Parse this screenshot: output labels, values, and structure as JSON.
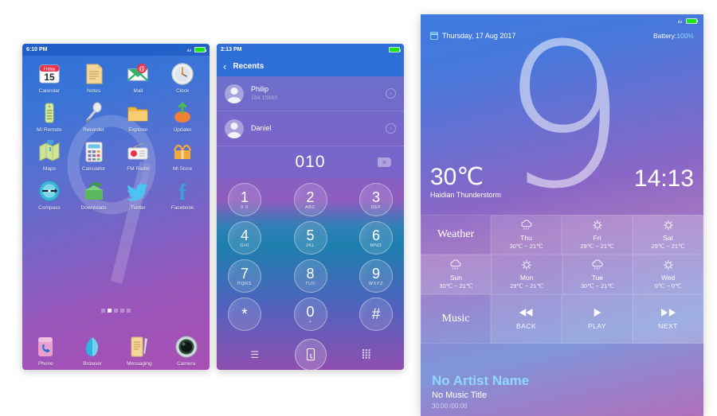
{
  "phone1": {
    "status": {
      "time": "6:10 PM",
      "signal_icon": "signal-icon",
      "battery_icon": "battery-full-icon"
    },
    "apps": [
      [
        {
          "label": "Calendar",
          "icon": "calendar-icon",
          "day": "Friday",
          "date": "15"
        },
        {
          "label": "Notes",
          "icon": "notes-icon"
        },
        {
          "label": "Mail",
          "icon": "mail-icon"
        },
        {
          "label": "Clock",
          "icon": "clock-icon"
        }
      ],
      [
        {
          "label": "Mi Remote",
          "icon": "remote-icon"
        },
        {
          "label": "Recorder",
          "icon": "microphone-icon"
        },
        {
          "label": "Explorer",
          "icon": "folder-icon"
        },
        {
          "label": "Updater",
          "icon": "updater-icon"
        }
      ],
      [
        {
          "label": "Maps",
          "icon": "map-icon"
        },
        {
          "label": "Calculator",
          "icon": "calculator-icon"
        },
        {
          "label": "FM Radio",
          "icon": "radio-icon"
        },
        {
          "label": "Mi Store",
          "icon": "store-icon"
        }
      ],
      [
        {
          "label": "Compass",
          "icon": "compass-icon"
        },
        {
          "label": "Downloads",
          "icon": "download-box-icon"
        },
        {
          "label": "Twitter",
          "icon": "twitter-icon"
        },
        {
          "label": "Facebook",
          "icon": "facebook-icon"
        }
      ]
    ],
    "page_dots": {
      "count": 5,
      "active_index": 1
    },
    "dock": [
      {
        "label": "Phone",
        "icon": "phone-icon"
      },
      {
        "label": "Browser",
        "icon": "browser-icon"
      },
      {
        "label": "Messaging",
        "icon": "messaging-icon"
      },
      {
        "label": "Camera",
        "icon": "camera-icon"
      }
    ]
  },
  "phone2": {
    "status": {
      "time": "2:13 PM",
      "battery_icon": "battery-full-icon"
    },
    "appbar": {
      "back_icon": "chevron-left-icon",
      "title": "Recents"
    },
    "contacts": [
      {
        "name": "Philip",
        "number": "184    15669",
        "avatar": "person-avatar",
        "arrow": "chevron-right-icon"
      },
      {
        "name": "Daniel",
        "number": "",
        "avatar": "person-avatar",
        "arrow": "chevron-right-icon"
      }
    ],
    "dialed_number": "010",
    "delete_icon": "backspace-icon",
    "keypad": [
      [
        {
          "digit": "1",
          "letters": "0 0"
        },
        {
          "digit": "2",
          "letters": "ABC"
        },
        {
          "digit": "3",
          "letters": "DEF"
        }
      ],
      [
        {
          "digit": "4",
          "letters": "GHI"
        },
        {
          "digit": "5",
          "letters": "JKL"
        },
        {
          "digit": "6",
          "letters": "MNO"
        }
      ],
      [
        {
          "digit": "7",
          "letters": "PQRS"
        },
        {
          "digit": "8",
          "letters": "TUV"
        },
        {
          "digit": "9",
          "letters": "WXYZ"
        }
      ],
      [
        {
          "digit": "*",
          "letters": ""
        },
        {
          "digit": "0",
          "letters": "+"
        },
        {
          "digit": "#",
          "letters": ""
        }
      ]
    ],
    "bottom_bar": {
      "menu_icon": "menu-lines-icon",
      "call_icon": "call-dial-icon",
      "keypad_icon": "keypad-dots-icon"
    }
  },
  "phone3": {
    "status": {
      "signal_icon": "signal-icon",
      "battery_icon": "battery-full-icon"
    },
    "header": {
      "calendar_icon": "calendar-icon",
      "date": "Thursday, 17 Aug 2017",
      "battery_label": "Battery:",
      "battery_value": "100%"
    },
    "big_digit": "9",
    "weather_now": {
      "temperature": "30℃",
      "location": "Haidian Thunderstorm"
    },
    "clock": "14:13",
    "weather_section_label": "Weather",
    "forecast": [
      {
        "day": "Thu",
        "range": "30℃ ~ 21℃",
        "icon": "rain-cloud-icon"
      },
      {
        "day": "Fri",
        "range": "29℃ ~ 21℃",
        "icon": "sun-icon"
      },
      {
        "day": "Sat",
        "range": "29℃ ~ 21℃",
        "icon": "sun-icon"
      },
      {
        "day": "Sun",
        "range": "30℃ ~ 21℃",
        "icon": "rain-cloud-icon"
      },
      {
        "day": "Mon",
        "range": "29℃ ~ 21℃",
        "icon": "sun-icon"
      },
      {
        "day": "Tue",
        "range": "30℃ ~ 21℃",
        "icon": "rain-cloud-icon"
      },
      {
        "day": "Wed",
        "range": "0℃ ~ 0℃",
        "icon": "sun-icon"
      }
    ],
    "music_section_label": "Music",
    "music_controls": [
      {
        "label": "BACK",
        "icon": "rewind-icon"
      },
      {
        "label": "PLAY",
        "icon": "play-icon"
      },
      {
        "label": "NEXT",
        "icon": "fast-forward-icon"
      }
    ],
    "now_playing": {
      "artist": "No Artist Name",
      "title": "No Music Title",
      "time": "30:00 /00:00"
    }
  },
  "colors": {
    "accent_blue": "#2f6fd8",
    "cyan_text": "#8fd8ff",
    "battery_green": "#19e619",
    "purple": "#9a56bb"
  }
}
